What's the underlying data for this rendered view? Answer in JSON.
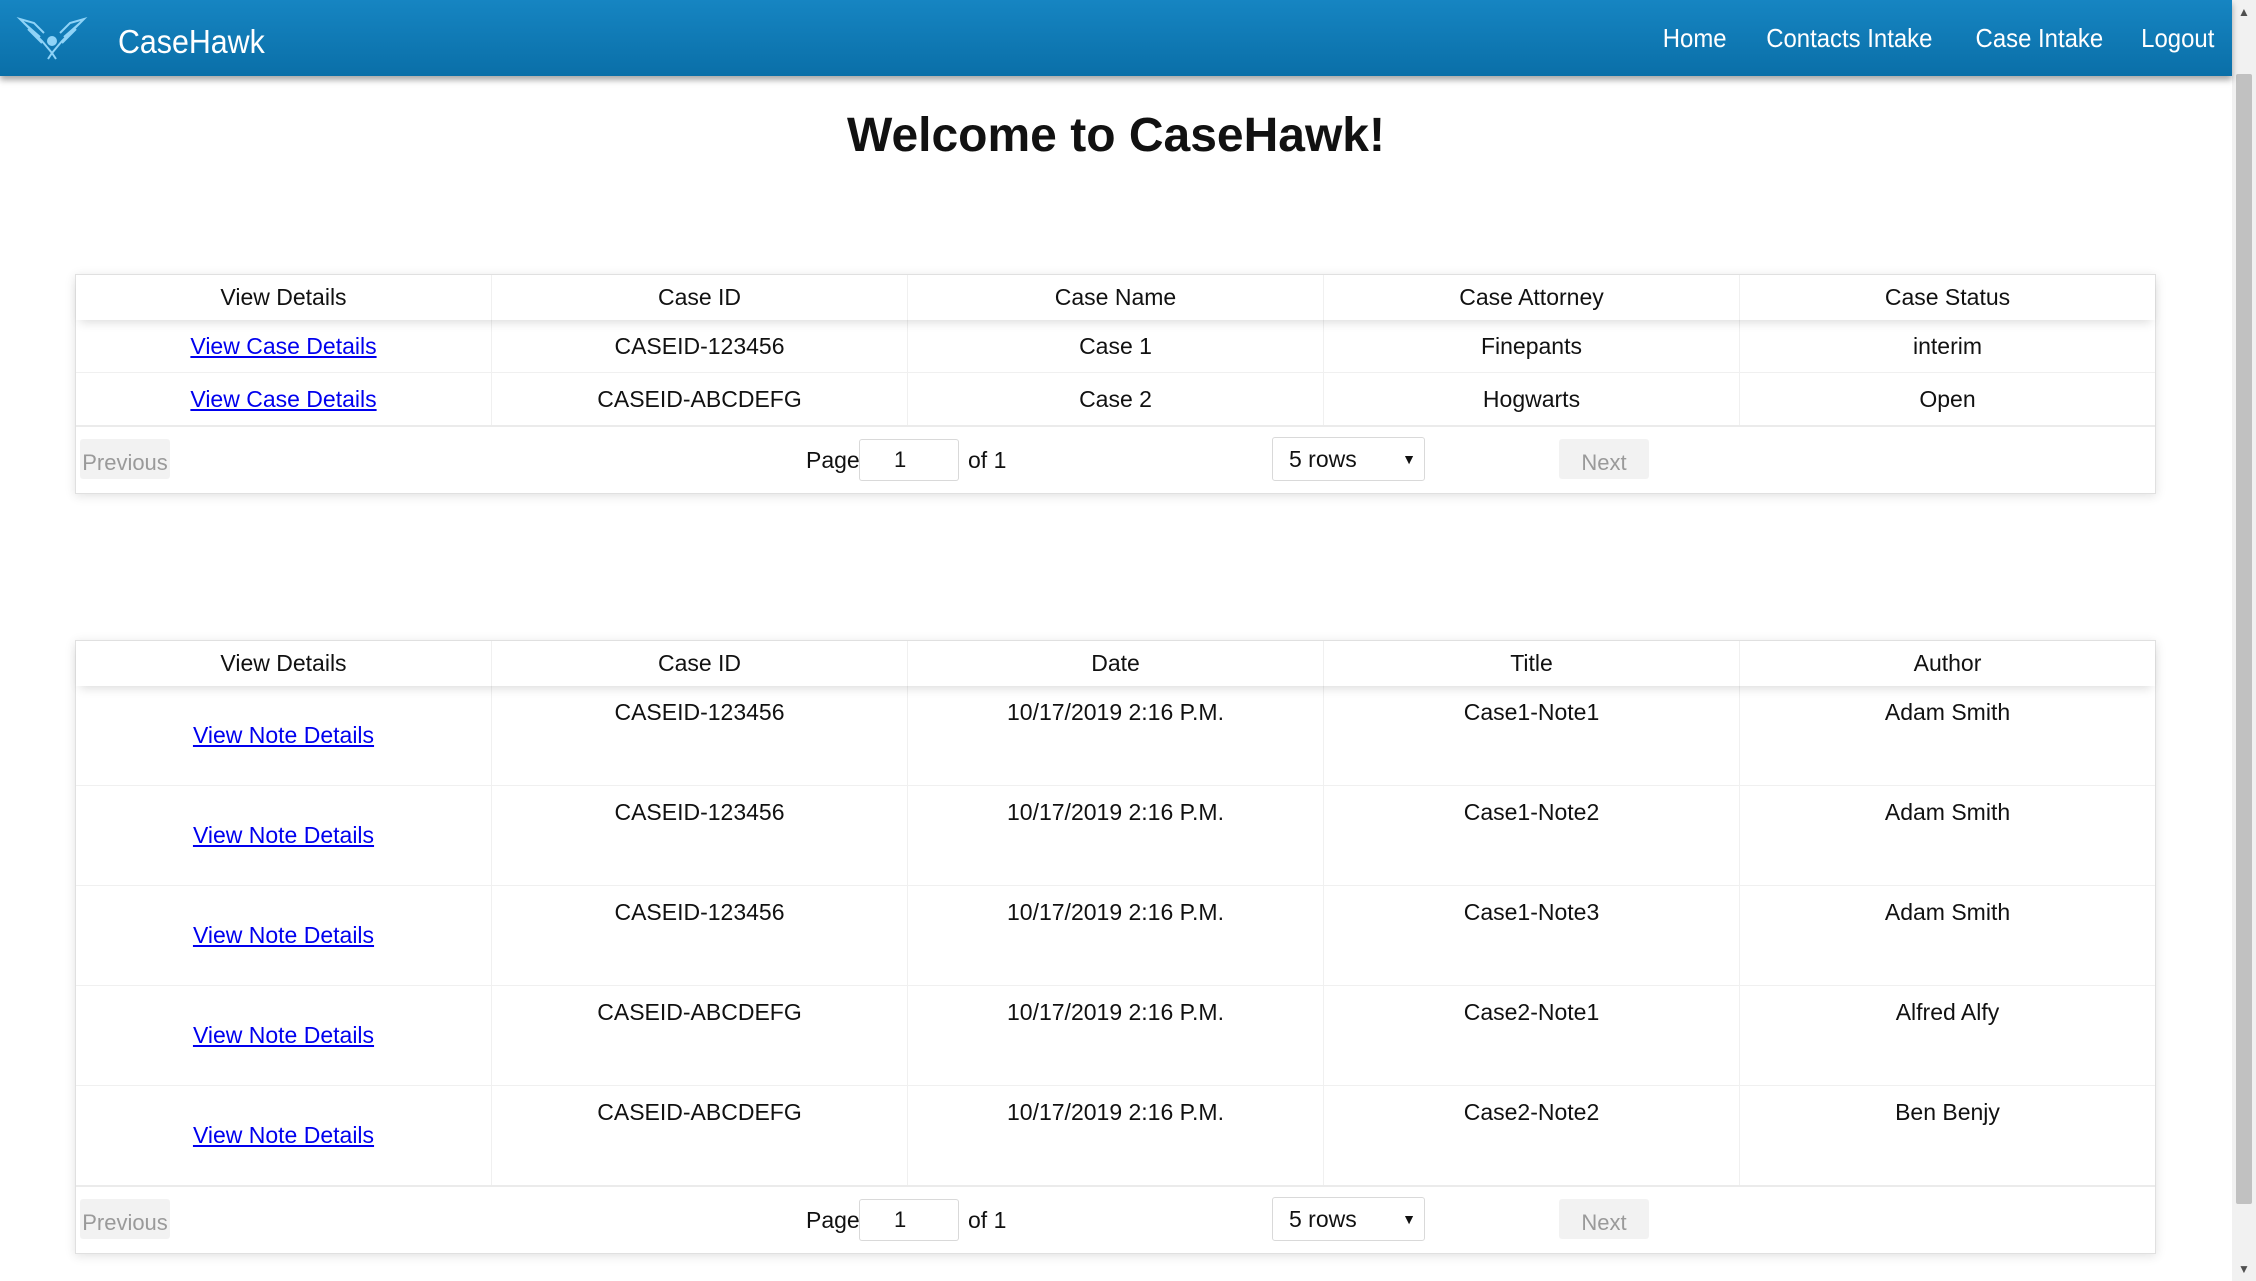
{
  "nav": {
    "brand": "CaseHawk",
    "links": [
      "Home",
      "Contacts Intake",
      "Case Intake",
      "Logout"
    ]
  },
  "page_title": "Welcome to CaseHawk!",
  "cases_table": {
    "headers": [
      "View Details",
      "Case ID",
      "Case Name",
      "Case Attorney",
      "Case Status"
    ],
    "rows": [
      {
        "link": "View Case Details",
        "case_id": "CASEID-123456",
        "case_name": "Case 1",
        "attorney": "Finepants",
        "status": "interim"
      },
      {
        "link": "View Case Details",
        "case_id": "CASEID-ABCDEFG",
        "case_name": "Case 2",
        "attorney": "Hogwarts",
        "status": "Open"
      }
    ],
    "pagination": {
      "previous": "Previous",
      "next": "Next",
      "page_label": "Page",
      "page_value": "1",
      "of_label": "of 1",
      "rows_option": "5 rows"
    }
  },
  "notes_table": {
    "headers": [
      "View Details",
      "Case ID",
      "Date",
      "Title",
      "Author"
    ],
    "rows": [
      {
        "link": "View Note Details",
        "case_id": "CASEID-123456",
        "date": "10/17/2019 2:16 P.M.",
        "title": "Case1-Note1",
        "author": "Adam Smith"
      },
      {
        "link": "View Note Details",
        "case_id": "CASEID-123456",
        "date": "10/17/2019 2:16 P.M.",
        "title": "Case1-Note2",
        "author": "Adam Smith"
      },
      {
        "link": "View Note Details",
        "case_id": "CASEID-123456",
        "date": "10/17/2019 2:16 P.M.",
        "title": "Case1-Note3",
        "author": "Adam Smith"
      },
      {
        "link": "View Note Details",
        "case_id": "CASEID-ABCDEFG",
        "date": "10/17/2019 2:16 P.M.",
        "title": "Case2-Note1",
        "author": "Alfred Alfy"
      },
      {
        "link": "View Note Details",
        "case_id": "CASEID-ABCDEFG",
        "date": "10/17/2019 2:16 P.M.",
        "title": "Case2-Note2",
        "author": "Ben Benjy"
      }
    ],
    "pagination": {
      "previous": "Previous",
      "next": "Next",
      "page_label": "Page",
      "page_value": "1",
      "of_label": "of 1",
      "rows_option": "5 rows"
    }
  },
  "icons": {
    "logo": "hawk-logo-icon",
    "scroll_up": "scroll-up-arrow-icon",
    "scroll_down": "scroll-down-arrow-icon",
    "select_arrow": "dropdown-arrow-icon"
  },
  "colors": {
    "navbar": "#0a7cbb",
    "link": "#0000ee",
    "disabled_button_text": "#9a9a9a"
  }
}
